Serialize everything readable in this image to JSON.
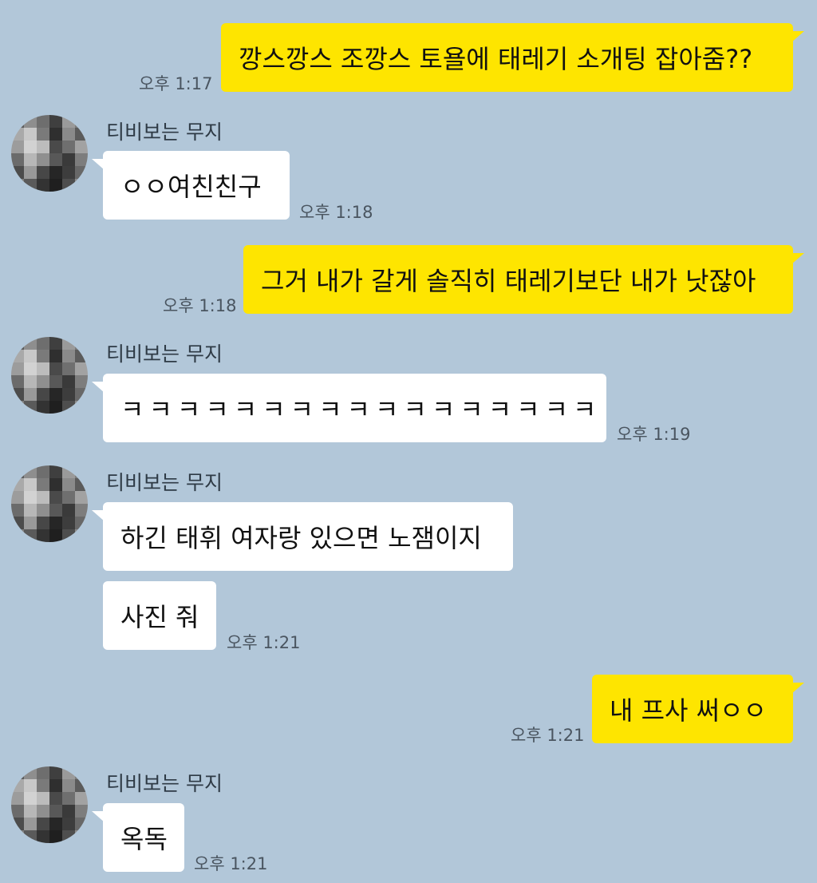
{
  "messages": [
    {
      "side": "me",
      "text": "깡스깡스 조깡스 토욜에 태레기 소개팅 잡아줌??",
      "time": "오후 1:17"
    },
    {
      "side": "them",
      "name": "티비보는 무지",
      "text": "ㅇㅇ여친친구",
      "time": "오후 1:18"
    },
    {
      "side": "me",
      "text": "그거 내가 갈게 솔직히 태레기보단 내가 낫잖아",
      "time": "오후 1:18"
    },
    {
      "side": "them",
      "name": "티비보는 무지",
      "text": "ㅋㅋㅋㅋㅋㅋㅋㅋㅋㅋㅋㅋㅋㅋㅋㅋㅋ",
      "time": "오후 1:19"
    },
    {
      "side": "them",
      "name": "티비보는 무지",
      "text": "하긴 태휘 여자랑 있으면 노잼이지"
    },
    {
      "side": "them",
      "text": "사진 줘",
      "time": "오후 1:21"
    },
    {
      "side": "me",
      "text": "내 프사 써ㅇㅇ",
      "time": "오후 1:21"
    },
    {
      "side": "them",
      "name": "티비보는 무지",
      "text": "옥독",
      "time": "오후 1:21"
    }
  ],
  "avatar": {
    "label": "profile-avatar-blurred"
  },
  "colors": {
    "background": "#b2c7d9",
    "my_bubble": "#fee500",
    "their_bubble": "#ffffff"
  }
}
